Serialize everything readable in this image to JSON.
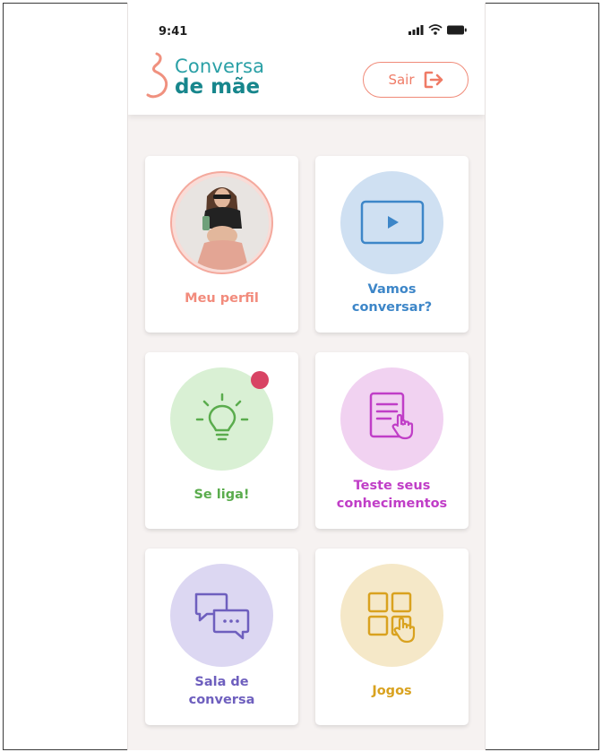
{
  "status_bar": {
    "time": "9:41"
  },
  "header": {
    "logo_line1": "Conversa",
    "logo_line2": "de mãe",
    "logout_label": "Sair"
  },
  "colors": {
    "brand_teal": "#2aa0a6",
    "logout": "#ef7b66",
    "profile": "#f28b7c",
    "video": "#3d86c8",
    "tips": "#5aac4d",
    "quiz": "#c03ec7",
    "chat": "#6e5fbe",
    "games": "#d9a21f",
    "badge": "#d84464"
  },
  "menu": [
    {
      "id": "profile",
      "label": "Meu perfil",
      "icon": "profile-photo"
    },
    {
      "id": "video",
      "label": "Vamos\nconversar?",
      "icon": "video-play-icon"
    },
    {
      "id": "tips",
      "label": "Se liga!",
      "icon": "lightbulb-icon",
      "has_notification": true
    },
    {
      "id": "quiz",
      "label": "Teste seus\nconhecimentos",
      "icon": "quiz-document-icon"
    },
    {
      "id": "chat",
      "label": "Sala de\nconversa",
      "icon": "chat-bubbles-icon"
    },
    {
      "id": "games",
      "label": "Jogos",
      "icon": "games-grid-icon"
    }
  ]
}
